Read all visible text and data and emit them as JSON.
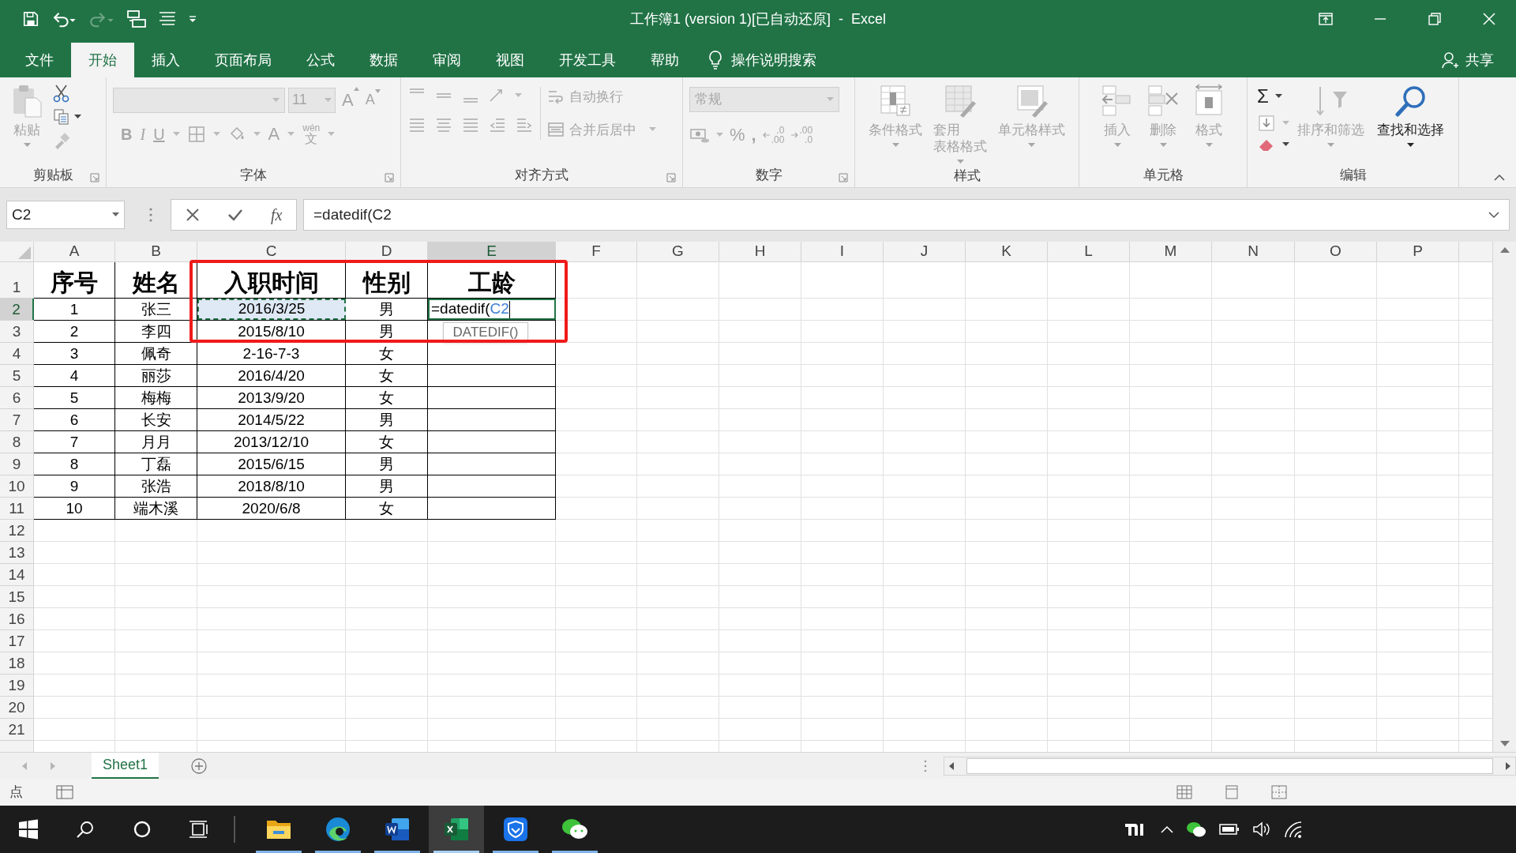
{
  "window": {
    "title": "工作簿1 (version 1)[已自动还原]  -  Excel"
  },
  "quick_access": [
    {
      "kind": "save",
      "disabled": false
    },
    {
      "kind": "undo",
      "disabled": false
    },
    {
      "kind": "redo",
      "disabled": true
    },
    {
      "kind": "touch",
      "disabled": false
    },
    {
      "kind": "form",
      "disabled": false
    },
    {
      "kind": "customize",
      "disabled": false
    }
  ],
  "tabs": [
    {
      "label": "文件",
      "selected": false
    },
    {
      "label": "开始",
      "selected": true
    },
    {
      "label": "插入",
      "selected": false
    },
    {
      "label": "页面布局",
      "selected": false
    },
    {
      "label": "公式",
      "selected": false
    },
    {
      "label": "数据",
      "selected": false
    },
    {
      "label": "审阅",
      "selected": false
    },
    {
      "label": "视图",
      "selected": false
    },
    {
      "label": "开发工具",
      "selected": false
    },
    {
      "label": "帮助",
      "selected": false
    }
  ],
  "tell_me": "操作说明搜索",
  "share": "共享",
  "ribbon": {
    "clipboard": {
      "label": "剪贴板",
      "paste": "粘贴"
    },
    "font": {
      "label": "字体",
      "size": "11",
      "grow": "A",
      "shrink": "A",
      "bold": "B",
      "italic": "I",
      "underline": "U",
      "font_color": "A",
      "phonetic": "wén",
      "phonetic_char": "文"
    },
    "alignment": {
      "label": "对齐方式",
      "wrap": "自动换行",
      "merge": "合并后居中"
    },
    "number": {
      "label": "数字",
      "format": "常规",
      "percent": "%",
      "comma": ",",
      "increase_decimal": [
        ".0",
        ".00"
      ],
      "decrease_decimal": [
        ".00",
        ".0"
      ]
    },
    "styles": {
      "label": "样式",
      "buttons": [
        {
          "kind": "conditional",
          "lines": [
            "条件格式"
          ],
          "disabled": true
        },
        {
          "kind": "table",
          "lines": [
            "套用",
            "表格格式"
          ],
          "disabled": true
        },
        {
          "kind": "cellstyle",
          "lines": [
            "单元格样式"
          ],
          "disabled": true
        }
      ]
    },
    "cells": {
      "label": "单元格",
      "buttons": [
        {
          "kind": "insert",
          "lines": [
            "插入"
          ],
          "disabled": true
        },
        {
          "kind": "delete",
          "lines": [
            "删除"
          ],
          "disabled": true
        },
        {
          "kind": "format",
          "lines": [
            "格式"
          ],
          "disabled": true
        }
      ]
    },
    "editing": {
      "label": "编辑",
      "sum": "Σ",
      "buttons": [
        {
          "kind": "sort",
          "lines": [
            "排序和筛选"
          ],
          "disabled": true
        },
        {
          "kind": "find",
          "lines": [
            "查找和选择"
          ],
          "disabled": false
        }
      ]
    }
  },
  "formula_bar": {
    "name_box": "C2",
    "fx": "fx",
    "formula": "=datedif(C2"
  },
  "sheet": {
    "columns": [
      {
        "label": "A",
        "selected": false
      },
      {
        "label": "B",
        "selected": false
      },
      {
        "label": "C",
        "selected": false
      },
      {
        "label": "D",
        "selected": false
      },
      {
        "label": "E",
        "selected": true
      },
      {
        "label": "F",
        "selected": false
      },
      {
        "label": "G",
        "selected": false
      },
      {
        "label": "H",
        "selected": false
      },
      {
        "label": "I",
        "selected": false
      },
      {
        "label": "J",
        "selected": false
      },
      {
        "label": "K",
        "selected": false
      },
      {
        "label": "L",
        "selected": false
      },
      {
        "label": "M",
        "selected": false
      },
      {
        "label": "N",
        "selected": false
      },
      {
        "label": "O",
        "selected": false
      },
      {
        "label": "P",
        "selected": false
      }
    ],
    "rows": [
      {
        "header": "1",
        "selected": false,
        "cells": [
          "序号",
          "姓名",
          "入职时间",
          "性别",
          "工龄"
        ]
      },
      {
        "header": "2",
        "selected": true,
        "cells": [
          "1",
          "张三",
          {
            "text": "2016/3/25",
            "referenced": true
          },
          "男",
          {
            "kind": "editing",
            "text": "=datedif(",
            "ref": "C2"
          }
        ]
      },
      {
        "header": "3",
        "selected": false,
        "cells": [
          "2",
          "李四",
          "2015/8/10",
          "男",
          ""
        ]
      },
      {
        "header": "4",
        "selected": false,
        "cells": [
          "3",
          "佩奇",
          "2-16-7-3",
          "女",
          ""
        ]
      },
      {
        "header": "5",
        "selected": false,
        "cells": [
          "4",
          "丽莎",
          "2016/4/20",
          "女",
          ""
        ]
      },
      {
        "header": "6",
        "selected": false,
        "cells": [
          "5",
          "梅梅",
          "2013/9/20",
          "女",
          ""
        ]
      },
      {
        "header": "7",
        "selected": false,
        "cells": [
          "6",
          "长安",
          "2014/5/22",
          "男",
          ""
        ]
      },
      {
        "header": "8",
        "selected": false,
        "cells": [
          "7",
          "月月",
          "2013/12/10",
          "女",
          ""
        ]
      },
      {
        "header": "9",
        "selected": false,
        "cells": [
          "8",
          "丁磊",
          "2015/6/15",
          "男",
          ""
        ]
      },
      {
        "header": "10",
        "selected": false,
        "cells": [
          "9",
          "张浩",
          "2018/8/10",
          "男",
          ""
        ]
      },
      {
        "header": "11",
        "selected": false,
        "cells": [
          "10",
          "端木溪",
          "2020/6/8",
          "女",
          ""
        ]
      },
      {
        "header": "12",
        "selected": false,
        "cells": []
      },
      {
        "header": "13",
        "selected": false,
        "cells": []
      },
      {
        "header": "14",
        "selected": false,
        "cells": []
      },
      {
        "header": "15",
        "selected": false,
        "cells": []
      },
      {
        "header": "16",
        "selected": false,
        "cells": []
      },
      {
        "header": "17",
        "selected": false,
        "cells": []
      },
      {
        "header": "18",
        "selected": false,
        "cells": []
      },
      {
        "header": "19",
        "selected": false,
        "cells": []
      },
      {
        "header": "20",
        "selected": false,
        "cells": []
      },
      {
        "header": "21",
        "selected": false,
        "cells": []
      }
    ],
    "tooltip": "DATEDIF()"
  },
  "sheet_tabs": [
    {
      "label": "Sheet1",
      "selected": true
    }
  ],
  "status_bar": {
    "mode": "点"
  },
  "taskbar": {
    "apps": [
      {
        "kind": "explorer",
        "active": false
      },
      {
        "kind": "edge",
        "active": false
      },
      {
        "kind": "word",
        "active": false
      },
      {
        "kind": "excel",
        "active": true
      },
      {
        "kind": "shield",
        "active": false
      },
      {
        "kind": "wechat",
        "active": false
      }
    ]
  }
}
